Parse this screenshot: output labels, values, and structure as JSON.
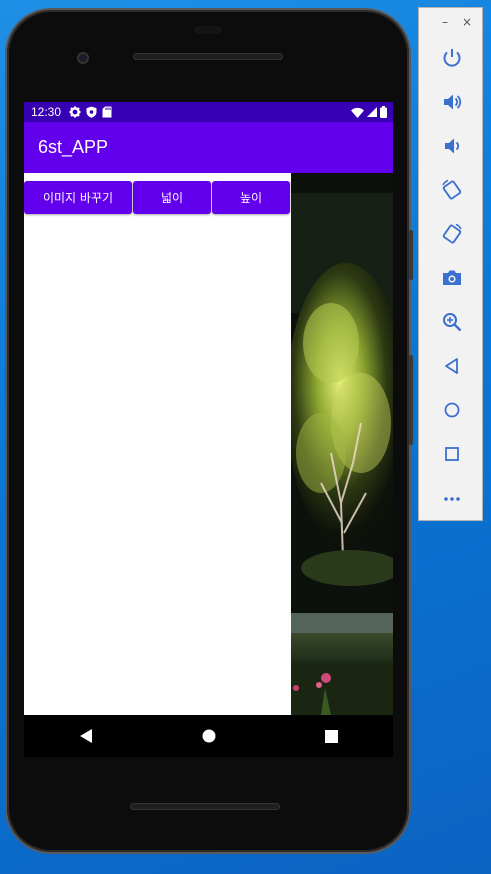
{
  "emulator_panel": {
    "tools": [
      {
        "name": "power-icon"
      },
      {
        "name": "volume-up-icon"
      },
      {
        "name": "volume-down-icon"
      },
      {
        "name": "rotate-left-icon"
      },
      {
        "name": "rotate-right-icon"
      },
      {
        "name": "screenshot-icon"
      },
      {
        "name": "zoom-icon"
      },
      {
        "name": "back-icon"
      },
      {
        "name": "home-icon"
      },
      {
        "name": "overview-icon"
      },
      {
        "name": "more-icon"
      }
    ],
    "minimize_glyph": "–",
    "close_glyph": "×"
  },
  "status_bar": {
    "time": "12:30"
  },
  "app_bar": {
    "title": "6st_APP"
  },
  "buttons": {
    "change_image": "이미지 바꾸기",
    "width": "넓이",
    "height": "높이"
  },
  "colors": {
    "status_bar": "#3700b3",
    "primary": "#6200ee",
    "desktop": "#0a78d6"
  }
}
